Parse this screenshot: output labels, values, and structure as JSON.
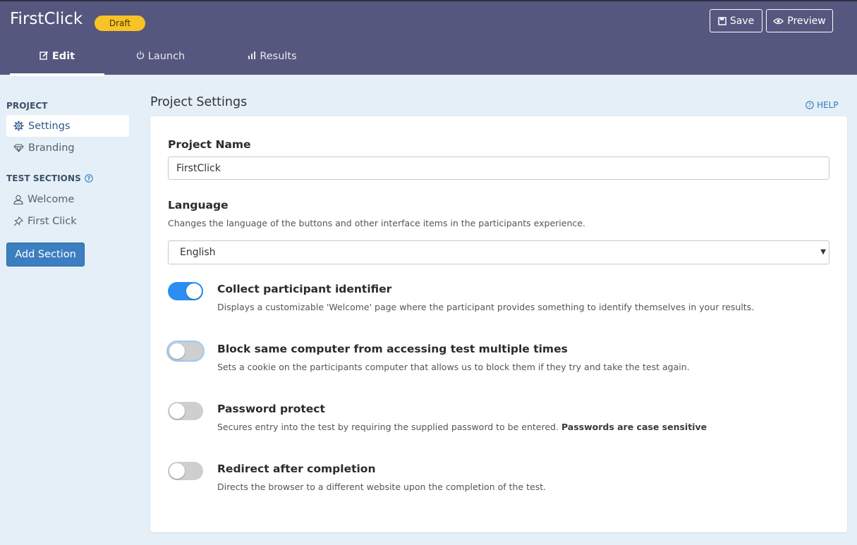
{
  "header": {
    "app_title": "FirstClick",
    "status_badge": "Draft",
    "save_label": "Save",
    "preview_label": "Preview",
    "tabs": [
      {
        "label": "Edit",
        "icon": "edit-icon",
        "active": true
      },
      {
        "label": "Launch",
        "icon": "power-icon",
        "active": false
      },
      {
        "label": "Results",
        "icon": "bar-chart-icon",
        "active": false
      }
    ]
  },
  "sidebar": {
    "project_heading": "PROJECT",
    "project_items": [
      {
        "label": "Settings",
        "icon": "gear-icon",
        "active": true
      },
      {
        "label": "Branding",
        "icon": "diamond-icon",
        "active": false
      }
    ],
    "sections_heading": "TEST SECTIONS",
    "section_items": [
      {
        "label": "Welcome",
        "icon": "user-icon"
      },
      {
        "label": "First Click",
        "icon": "pin-icon"
      }
    ],
    "add_section_label": "Add Section"
  },
  "main": {
    "page_title": "Project Settings",
    "help_label": "HELP",
    "project_name": {
      "label": "Project Name",
      "value": "FirstClick"
    },
    "language": {
      "label": "Language",
      "help": "Changes the language of the buttons and other interface items in the participants experience.",
      "selected": "English"
    },
    "options": [
      {
        "title": "Collect participant identifier",
        "description": "Displays a customizable 'Welcome' page where the participant provides something to identify themselves in your results.",
        "enabled": true
      },
      {
        "title": "Block same computer from accessing test multiple times",
        "description": "Sets a cookie on the participants computer that allows us to block them if they try and take the test again.",
        "enabled": false
      },
      {
        "title": "Password protect",
        "description": "Secures entry into the test by requiring the supplied password to be entered.",
        "description_bold": "Passwords are case sensitive",
        "enabled": false
      },
      {
        "title": "Redirect after completion",
        "description": "Directs the browser to a different website upon the completion of the test.",
        "enabled": false
      }
    ]
  },
  "colors": {
    "header_bg": "#56577e",
    "page_bg": "#e4eff7",
    "badge": "#f7c325",
    "accent": "#3b7fc1",
    "toggle_on": "#2b8ef0",
    "toggle_off": "#cfcfcf"
  }
}
